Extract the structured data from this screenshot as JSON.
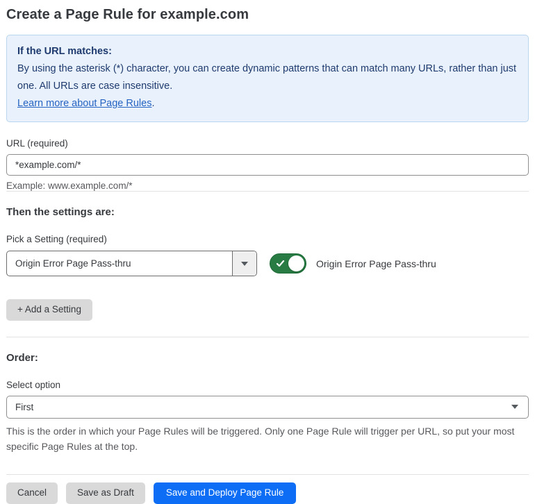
{
  "page": {
    "title": "Create a Page Rule for example.com"
  },
  "info_box": {
    "heading": "If the URL matches:",
    "body": "By using the asterisk (*) character, you can create dynamic patterns that can match many URLs, rather than just one. All URLs are case insensitive.",
    "link_label": "Learn more about Page Rules",
    "link_suffix": "."
  },
  "url_field": {
    "label": "URL (required)",
    "value": "*example.com/*",
    "helper": "Example: www.example.com/*"
  },
  "settings_section": {
    "heading": "Then the settings are:",
    "picker_label": "Pick a Setting (required)",
    "picker_value": "Origin Error Page Pass-thru",
    "toggle_state": "on",
    "toggle_label": "Origin Error Page Pass-thru",
    "add_button_label": "+ Add a Setting"
  },
  "order_section": {
    "heading": "Order:",
    "select_label": "Select option",
    "select_value": "First",
    "helper": "This is the order in which your Page Rules will be triggered. Only one Page Rule will trigger per URL, so put your most specific Page Rules at the top."
  },
  "footer": {
    "cancel_label": "Cancel",
    "save_draft_label": "Save as Draft",
    "save_deploy_label": "Save and Deploy Page Rule"
  },
  "icons": {
    "toggle_check": "checkmark-icon",
    "picker_caret": "chevron-down-icon",
    "select_caret": "chevron-down-icon"
  },
  "colors": {
    "primary_button_blue": "#0d6ef5",
    "toggle_green": "#287b43",
    "info_box_bg": "#e9f2fc",
    "info_box_border": "#b9d5ef",
    "info_text_navy": "#1e3a6e",
    "link_blue": "#2563c2",
    "secondary_button_gray": "#d9d9d9"
  }
}
